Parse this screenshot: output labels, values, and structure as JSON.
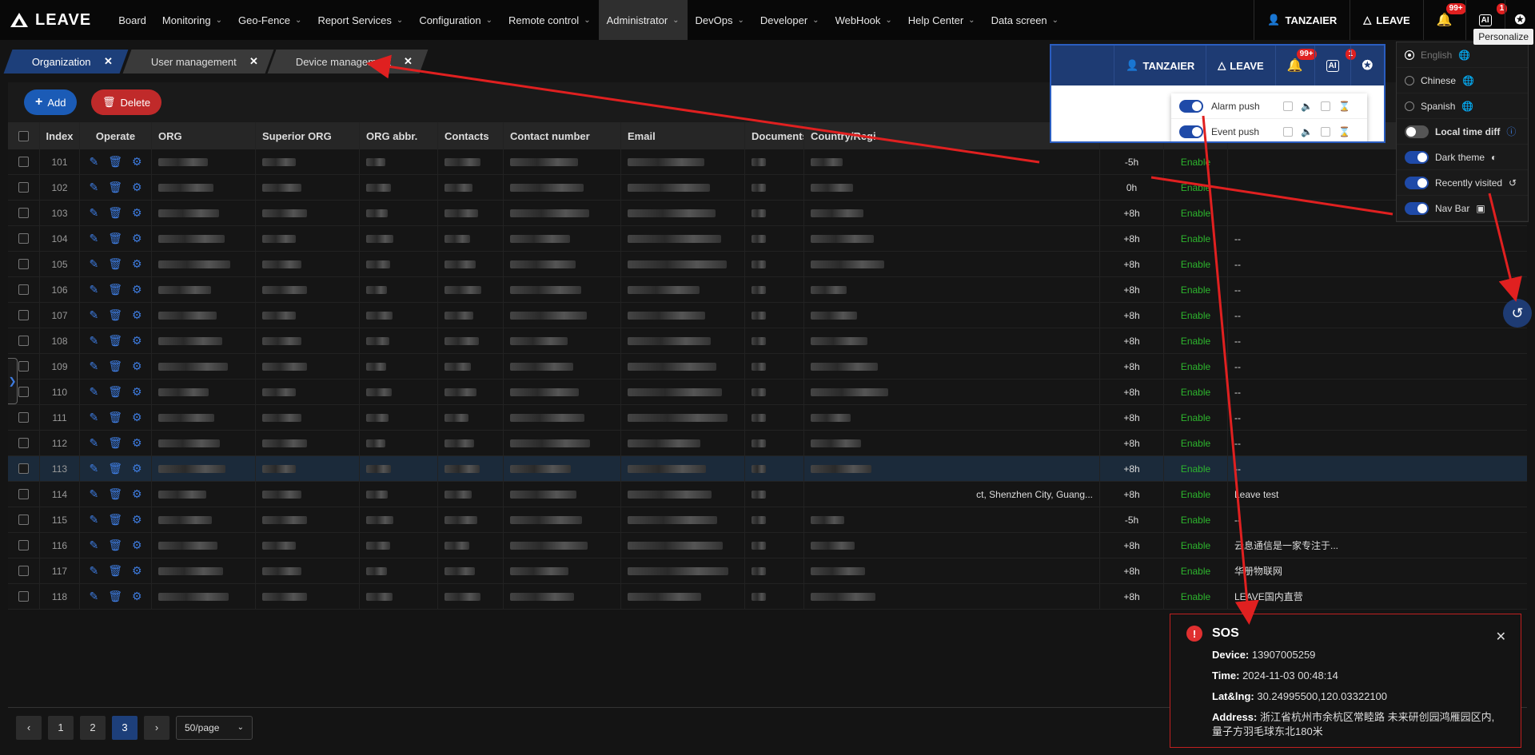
{
  "app": {
    "brand": "LEAVE"
  },
  "menu": [
    {
      "label": "Board",
      "chevron": false
    },
    {
      "label": "Monitoring",
      "chevron": true
    },
    {
      "label": "Geo-Fence",
      "chevron": true
    },
    {
      "label": "Report Services",
      "chevron": true
    },
    {
      "label": "Configuration",
      "chevron": true
    },
    {
      "label": "Remote control",
      "chevron": true
    },
    {
      "label": "Administrator",
      "chevron": true,
      "active": true
    },
    {
      "label": "DevOps",
      "chevron": true
    },
    {
      "label": "Developer",
      "chevron": true
    },
    {
      "label": "WebHook",
      "chevron": true
    },
    {
      "label": "Help Center",
      "chevron": true
    },
    {
      "label": "Data screen",
      "chevron": true
    }
  ],
  "user": {
    "name": "TANZAIER",
    "org": "LEAVE",
    "alarm_badge": "99+",
    "ai_badge": "1"
  },
  "tooltip": "Personalize",
  "tabs": [
    {
      "label": "Organization",
      "active": true
    },
    {
      "label": "User management"
    },
    {
      "label": "Device management"
    }
  ],
  "toolbar": {
    "add": "Add",
    "delete": "Delete"
  },
  "columns": {
    "index": "Index",
    "operate": "Operate",
    "org": "ORG",
    "superior": "Superior ORG",
    "abbr": "ORG abbr.",
    "contacts": "Contacts",
    "contact_number": "Contact number",
    "email": "Email",
    "documents": "Documents",
    "country": "Country/Regi"
  },
  "rows": [
    {
      "index": "101",
      "tz": "-5h",
      "status": "Enable",
      "remark": ""
    },
    {
      "index": "102",
      "tz": "0h",
      "status": "Enable",
      "remark": ""
    },
    {
      "index": "103",
      "tz": "+8h",
      "status": "Enable",
      "remark": ""
    },
    {
      "index": "104",
      "tz": "+8h",
      "status": "Enable",
      "remark": "--"
    },
    {
      "index": "105",
      "tz": "+8h",
      "status": "Enable",
      "remark": "--"
    },
    {
      "index": "106",
      "tz": "+8h",
      "status": "Enable",
      "remark": "--"
    },
    {
      "index": "107",
      "tz": "+8h",
      "status": "Enable",
      "remark": "--"
    },
    {
      "index": "108",
      "tz": "+8h",
      "status": "Enable",
      "remark": "--"
    },
    {
      "index": "109",
      "tz": "+8h",
      "status": "Enable",
      "remark": "--"
    },
    {
      "index": "110",
      "tz": "+8h",
      "status": "Enable",
      "remark": "--"
    },
    {
      "index": "111",
      "tz": "+8h",
      "status": "Enable",
      "remark": "--"
    },
    {
      "index": "112",
      "tz": "+8h",
      "status": "Enable",
      "remark": "--"
    },
    {
      "index": "113",
      "tz": "+8h",
      "status": "Enable",
      "remark": "--",
      "highlight": true
    },
    {
      "index": "114",
      "tz": "+8h",
      "status": "Enable",
      "remark": "Leave test",
      "address": "ct, Shenzhen City, Guang..."
    },
    {
      "index": "115",
      "tz": "-5h",
      "status": "Enable",
      "remark": "--"
    },
    {
      "index": "116",
      "tz": "+8h",
      "status": "Enable",
      "remark": "云息通信是一家专注于..."
    },
    {
      "index": "117",
      "tz": "+8h",
      "status": "Enable",
      "remark": "华册物联网"
    },
    {
      "index": "118",
      "tz": "+8h",
      "status": "Enable",
      "remark": "LEAVE国内直营"
    }
  ],
  "pager": {
    "pages": [
      "1",
      "2",
      "3"
    ],
    "current": "3",
    "page_size": "50/page"
  },
  "popup": {
    "user": "TANZAIER",
    "org": "LEAVE",
    "alarm_badge": "99+",
    "ai_badge": "1",
    "alarm_push": "Alarm push",
    "event_push": "Event push"
  },
  "personalize": {
    "english": "English",
    "chinese": "Chinese",
    "spanish": "Spanish",
    "local_time_diff": "Local time diff",
    "dark_theme": "Dark theme",
    "recently_visited": "Recently visited",
    "nav_bar": "Nav Bar"
  },
  "sos": {
    "title": "SOS",
    "device_label": "Device:",
    "device": "13907005259",
    "time_label": "Time:",
    "time": "2024-11-03 00:48:14",
    "latlng_label": "Lat&lng:",
    "latlng": "30.24995500,120.03322100",
    "address_label": "Address:",
    "address": "浙江省杭州市余杭区常睦路 未来研创园鸿雁园区内,",
    "address2": "量子方羽毛球东北180米"
  },
  "colors": {
    "accent": "#1d3f7a",
    "enable": "#2db52d",
    "danger": "#c02a2a",
    "arrow": "#e02020"
  }
}
